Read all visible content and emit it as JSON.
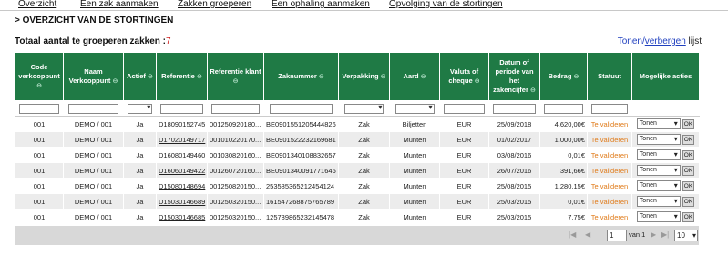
{
  "topnav": [
    "Overzicht",
    "Een zak aanmaken",
    "Zakken groeperen",
    "Een ophaling aanmaken",
    "Opvolging van de stortingen"
  ],
  "page_title": "> OVERZICHT VAN DE STORTINGEN",
  "total": {
    "label": "Totaal aantal te groeperen zakken :",
    "count": "7"
  },
  "toggle": {
    "show": "Tonen",
    "sep": "/",
    "hide": "verbergen",
    "suffix": " lijst"
  },
  "headers": [
    "Code verkooppunt",
    "Naam Verkooppunt",
    "Actief",
    "Referentie",
    "Referentie klant",
    "Zaknummer",
    "Verpakking",
    "Aard",
    "Valuta of cheque",
    "Datum of periode van het zakencijfer",
    "Bedrag",
    "Statuut",
    "Mogelijke acties"
  ],
  "sort_icon": "⊖",
  "rows": [
    {
      "code": "001",
      "naam": "DEMO / 001",
      "actief": "Ja",
      "ref": "D18090152745",
      "refklant": "001250920180...",
      "zaknr": "BE0901551205444826",
      "verp": "Zak",
      "aard": "Biljetten",
      "valuta": "EUR",
      "datum": "25/09/2018",
      "bedrag": "4.620,00€",
      "statuut": "Te valideren",
      "actie": "Tonen",
      "ok": "OK"
    },
    {
      "code": "001",
      "naam": "DEMO / 001",
      "actief": "Ja",
      "ref": "D17020149717",
      "refklant": "001010220170...",
      "zaknr": "BE0901522232169681",
      "verp": "Zak",
      "aard": "Munten",
      "valuta": "EUR",
      "datum": "01/02/2017",
      "bedrag": "1.000,00€",
      "statuut": "Te valideren",
      "actie": "Tonen",
      "ok": "OK"
    },
    {
      "code": "001",
      "naam": "DEMO / 001",
      "actief": "Ja",
      "ref": "D16080149460",
      "refklant": "001030820160...",
      "zaknr": "BE0901340108832657",
      "verp": "Zak",
      "aard": "Munten",
      "valuta": "EUR",
      "datum": "03/08/2016",
      "bedrag": "0,01€",
      "statuut": "Te valideren",
      "actie": "Tonen",
      "ok": "OK"
    },
    {
      "code": "001",
      "naam": "DEMO / 001",
      "actief": "Ja",
      "ref": "D16060149422",
      "refklant": "001260720160...",
      "zaknr": "BE0901340091771646",
      "verp": "Zak",
      "aard": "Munten",
      "valuta": "EUR",
      "datum": "26/07/2016",
      "bedrag": "391,66€",
      "statuut": "Te valideren",
      "actie": "Tonen",
      "ok": "OK"
    },
    {
      "code": "001",
      "naam": "DEMO / 001",
      "actief": "Ja",
      "ref": "D15080148694",
      "refklant": "001250820150...",
      "zaknr": "253585365212454124",
      "verp": "Zak",
      "aard": "Munten",
      "valuta": "EUR",
      "datum": "25/08/2015",
      "bedrag": "1.280,15€",
      "statuut": "Te valideren",
      "actie": "Tonen",
      "ok": "OK"
    },
    {
      "code": "001",
      "naam": "DEMO / 001",
      "actief": "Ja",
      "ref": "D15030146689",
      "refklant": "001250320150...",
      "zaknr": "161547268875765789",
      "verp": "Zak",
      "aard": "Munten",
      "valuta": "EUR",
      "datum": "25/03/2015",
      "bedrag": "0,01€",
      "statuut": "Te valideren",
      "actie": "Tonen",
      "ok": "OK"
    },
    {
      "code": "001",
      "naam": "DEMO / 001",
      "actief": "Ja",
      "ref": "D15030146685",
      "refklant": "001250320150...",
      "zaknr": "125789865232145478",
      "verp": "Zak",
      "aard": "Munten",
      "valuta": "EUR",
      "datum": "25/03/2015",
      "bedrag": "7,75€",
      "statuut": "Te valideren",
      "actie": "Tonen",
      "ok": "OK"
    }
  ],
  "pager": {
    "first": "|◀",
    "prev": "◀",
    "page": "1",
    "van": "van 1",
    "next": "▶",
    "last": "▶|",
    "size": "10"
  },
  "colors": {
    "header_bg": "#1f7a45",
    "status": "#e07b1a",
    "count": "#d21f1f",
    "link": "#1f3fbf"
  }
}
